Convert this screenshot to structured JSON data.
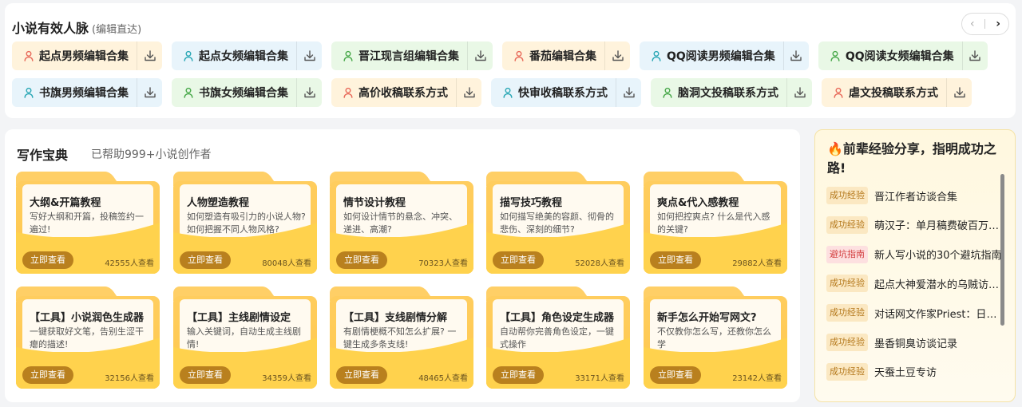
{
  "top": {
    "title": "小说有效人脉",
    "subtitle": "(编辑直达)",
    "row1": [
      {
        "label": "起点男频编辑合集",
        "color": "orange",
        "person": "#e86a5a"
      },
      {
        "label": "起点女频编辑合集",
        "color": "blue",
        "person": "#2aa7b5"
      },
      {
        "label": "晋江现言组编辑合集",
        "color": "green",
        "person": "#48a84a"
      },
      {
        "label": "番茄编辑合集",
        "color": "orange",
        "person": "#e86a5a"
      },
      {
        "label": "QQ阅读男频编辑合集",
        "color": "blue",
        "person": "#2aa7b5"
      },
      {
        "label": "QQ阅读女频编辑合集",
        "color": "green",
        "person": "#48a84a"
      }
    ],
    "row2": [
      {
        "label": "书旗男频编辑合集",
        "color": "blue",
        "person": "#2aa7b5"
      },
      {
        "label": "书旗女频编辑合集",
        "color": "green",
        "person": "#48a84a"
      },
      {
        "label": "高价收稿联系方式",
        "color": "orange",
        "person": "#e86a5a"
      },
      {
        "label": "快审收稿联系方式",
        "color": "blue",
        "person": "#2aa7b5"
      },
      {
        "label": "脑洞文投稿联系方式",
        "color": "green",
        "person": "#48a84a"
      },
      {
        "label": "虐文投稿联系方式",
        "color": "orange",
        "person": "#e86a5a"
      }
    ]
  },
  "main": {
    "title": "写作宝典",
    "subtitle": "已帮助999+小说创作者",
    "button_label": "立即查看",
    "cards": [
      {
        "title": "大纲&开篇教程",
        "desc": "写好大纲和开篇，投稿签约一遍过!",
        "views": "42555人查看"
      },
      {
        "title": "人物塑造教程",
        "desc": "如何塑造有吸引力的小说人物? 如何把握不同人物风格?",
        "views": "80048人查看"
      },
      {
        "title": "情节设计教程",
        "desc": "如何设计情节的悬念、冲突、递进、高潮?",
        "views": "70323人查看"
      },
      {
        "title": "描写技巧教程",
        "desc": "如何描写绝美的容颜、彻骨的悲伤、深刻的细节?",
        "views": "52028人查看"
      },
      {
        "title": "爽点&代入感教程",
        "desc": "如何把控爽点? 什么是代入感的关键?",
        "views": "29882人查看"
      },
      {
        "title": "【工具】小说润色生成器",
        "desc": "一键获取好文笔，告别生涩干瘪的描述!",
        "views": "32156人查看"
      },
      {
        "title": "【工具】主线剧情设定",
        "desc": "输入关键词，自动生成主线剧情!",
        "views": "34359人查看"
      },
      {
        "title": "【工具】支线剧情分解",
        "desc": "有剧情梗概不知怎么扩展? 一键生成多条支线!",
        "views": "48465人查看"
      },
      {
        "title": "【工具】角色设定生成器",
        "desc": "自动帮你完善角色设定，一键式操作",
        "views": "33171人查看"
      },
      {
        "title": "新手怎么开始写网文?",
        "desc": "不仅教你怎么写，还教你怎么学",
        "views": "23142人查看"
      }
    ]
  },
  "side": {
    "title": "🔥前辈经验分享，指明成功之路!",
    "items": [
      {
        "badge": "成功经验",
        "type": "ok",
        "text": "晋江作者访谈合集"
      },
      {
        "badge": "成功经验",
        "type": "ok",
        "text": "萌汉子：单月稿费破百万，..."
      },
      {
        "badge": "避坑指南",
        "type": "warn",
        "text": "新人写小说的30个避坑指南"
      },
      {
        "badge": "成功经验",
        "type": "ok",
        "text": "起点大神爱潜水的乌贼访谈..."
      },
      {
        "badge": "成功经验",
        "type": "ok",
        "text": "对话网文作家Priest：日常..."
      },
      {
        "badge": "成功经验",
        "type": "ok",
        "text": "墨香铜臭访谈记录"
      },
      {
        "badge": "成功经验",
        "type": "ok",
        "text": "天蚕土豆专访"
      }
    ]
  },
  "colors": {
    "chip_orange": "#fff3dc",
    "chip_blue": "#e8f4fb",
    "chip_green": "#e9f8e6",
    "folder_yellow": "#ffcd5e",
    "button_brown": "#b9801e"
  }
}
